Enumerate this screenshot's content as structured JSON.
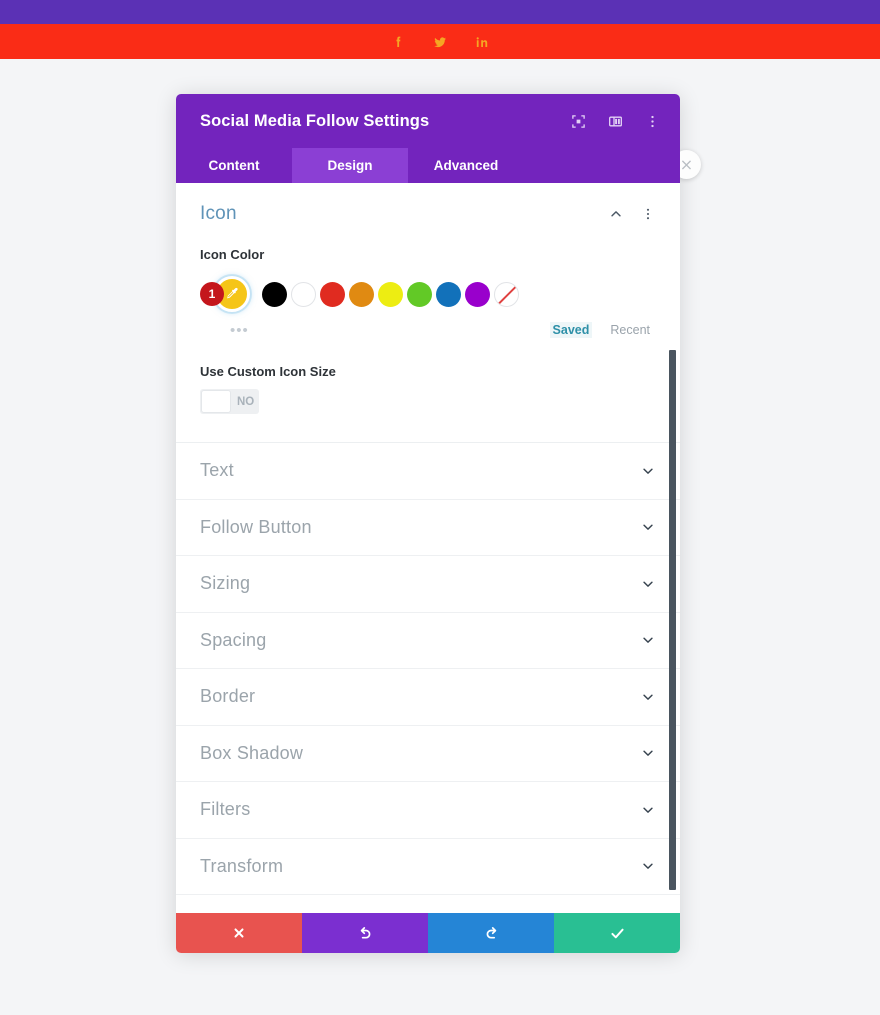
{
  "page": {
    "top_strip_color": "#5b31b5",
    "social_bar": {
      "background_color": "#fa2c16",
      "icon_color": "#f5a623",
      "icons": [
        {
          "name": "facebook-icon",
          "label": "f"
        },
        {
          "name": "twitter-icon",
          "label": "t"
        },
        {
          "name": "linkedin-icon",
          "label": "in"
        }
      ]
    }
  },
  "modal": {
    "title": "Social Media Follow Settings",
    "header_color": "#7324bd",
    "header_icons": [
      {
        "name": "fullscreen-icon",
        "label": "fullscreen"
      },
      {
        "name": "layout-view-icon",
        "label": "layout view"
      },
      {
        "name": "more-options-icon",
        "label": "more options"
      }
    ],
    "close_button": {
      "name": "close-icon",
      "label": "×"
    },
    "tabs": [
      {
        "label": "Content",
        "active": false
      },
      {
        "label": "Design",
        "active": true
      },
      {
        "label": "Advanced",
        "active": false
      }
    ],
    "icon_section": {
      "title": "Icon",
      "collapse_icon": "chevron-up-icon",
      "menu_icon": "more-options-icon",
      "color_field": {
        "label": "Icon Color",
        "selected_color": "#f5c518",
        "selected_badge": "1",
        "eyedropper_icon": "eyedropper-icon",
        "more_dots": "•••",
        "palette": [
          {
            "name": "black",
            "hex": "#000000"
          },
          {
            "name": "white",
            "hex": "#ffffff"
          },
          {
            "name": "red",
            "hex": "#e02b20"
          },
          {
            "name": "orange",
            "hex": "#e08a12"
          },
          {
            "name": "yellow",
            "hex": "#eded12"
          },
          {
            "name": "green",
            "hex": "#62c926"
          },
          {
            "name": "blue",
            "hex": "#1271ba"
          },
          {
            "name": "purple",
            "hex": "#9900cc"
          },
          {
            "name": "none",
            "hex": "transparent"
          }
        ],
        "filter_saved": "Saved",
        "filter_recent": "Recent"
      },
      "custom_size_toggle": {
        "label": "Use Custom Icon Size",
        "value": "NO"
      }
    },
    "sections": [
      {
        "label": "Text"
      },
      {
        "label": "Follow Button"
      },
      {
        "label": "Sizing"
      },
      {
        "label": "Spacing"
      },
      {
        "label": "Border"
      },
      {
        "label": "Box Shadow"
      },
      {
        "label": "Filters"
      },
      {
        "label": "Transform"
      }
    ],
    "actions": [
      {
        "name": "cancel-button",
        "icon": "close-x-icon",
        "color": "#e8534f"
      },
      {
        "name": "undo-button",
        "icon": "undo-icon",
        "color": "#7b2fd0"
      },
      {
        "name": "redo-button",
        "icon": "redo-icon",
        "color": "#2585d6"
      },
      {
        "name": "save-button",
        "icon": "checkmark-icon",
        "color": "#29bf93"
      }
    ]
  }
}
